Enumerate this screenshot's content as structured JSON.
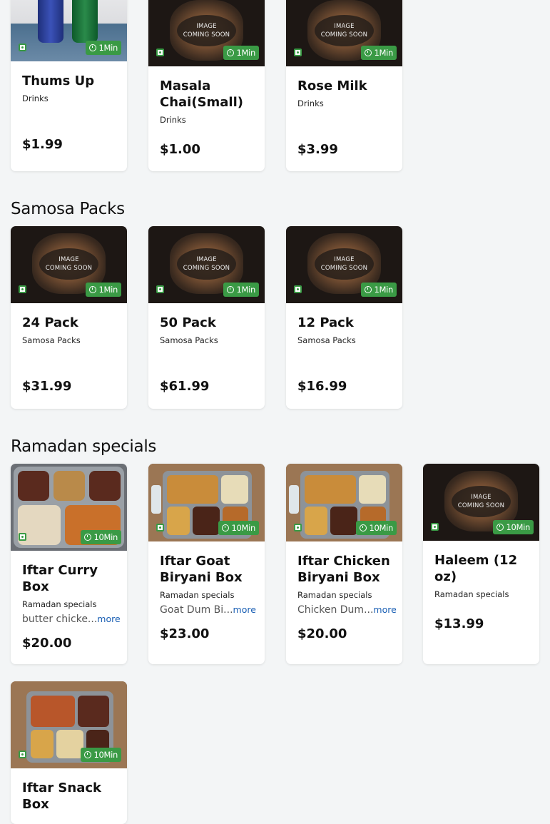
{
  "sections": {
    "samosa_title": "Samosa Packs",
    "ramadan_title": "Ramadan specials"
  },
  "placeholder": {
    "line1": "IMAGE",
    "line2": "COMING SOON"
  },
  "drinks": [
    {
      "name": "Thums Up",
      "category": "Drinks",
      "price": "$1.99",
      "time": "1Min"
    },
    {
      "name": "Masala Chai(Small)",
      "category": "Drinks",
      "price": "$1.00",
      "time": "1Min"
    },
    {
      "name": "Rose Milk",
      "category": "Drinks",
      "price": "$3.99",
      "time": "1Min"
    }
  ],
  "samosa": [
    {
      "name": "24 Pack",
      "category": "Samosa Packs",
      "price": "$31.99",
      "time": "1Min"
    },
    {
      "name": "50 Pack",
      "category": "Samosa Packs",
      "price": "$61.99",
      "time": "1Min"
    },
    {
      "name": "12 Pack",
      "category": "Samosa Packs",
      "price": "$16.99",
      "time": "1Min"
    }
  ],
  "ramadan": [
    {
      "name": "Iftar Curry Box",
      "category": "Ramadan specials",
      "desc": "butter chicke...",
      "more": "more",
      "price": "$20.00",
      "time": "10Min"
    },
    {
      "name": "Iftar Goat Biryani Box",
      "category": "Ramadan specials",
      "desc": "Goat Dum Bi...",
      "more": "more",
      "price": "$23.00",
      "time": "10Min"
    },
    {
      "name": "Iftar Chicken Biryani Box",
      "category": "Ramadan specials",
      "desc": "Chicken Dum...",
      "more": "more",
      "price": "$20.00",
      "time": "10Min"
    },
    {
      "name": "Haleem (12 oz)",
      "category": "Ramadan specials",
      "price": "$13.99",
      "time": "10Min"
    },
    {
      "name": "Iftar Snack Box",
      "time": "10Min"
    }
  ],
  "colors": {
    "accent_green": "#3a9a45",
    "link_blue": "#1a5fb4",
    "background": "#f3f5f6"
  }
}
